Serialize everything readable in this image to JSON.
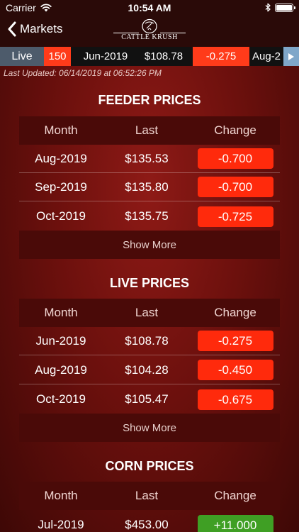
{
  "status_bar": {
    "carrier": "Carrier",
    "time": "10:54 AM"
  },
  "nav": {
    "back_label": "Markets",
    "logo_text": "CATTLE KRUSH"
  },
  "ticker": {
    "live_label": "Live",
    "items": [
      "150",
      "Jun-2019",
      "$108.78",
      "-0.275",
      "Aug-2"
    ]
  },
  "last_updated": "Last Updated: 06/14/2019 at 06:52:26 PM",
  "columns": {
    "month": "Month",
    "last": "Last",
    "change": "Change"
  },
  "feeder": {
    "title": "FEEDER PRICES",
    "rows": [
      {
        "month": "Aug-2019",
        "last": "$135.53",
        "change": "-0.700"
      },
      {
        "month": "Sep-2019",
        "last": "$135.80",
        "change": "-0.700"
      },
      {
        "month": "Oct-2019",
        "last": "$135.75",
        "change": "-0.725"
      }
    ],
    "show_more": "Show More"
  },
  "live": {
    "title": "LIVE PRICES",
    "rows": [
      {
        "month": "Jun-2019",
        "last": "$108.78",
        "change": "-0.275"
      },
      {
        "month": "Aug-2019",
        "last": "$104.28",
        "change": "-0.450"
      },
      {
        "month": "Oct-2019",
        "last": "$105.47",
        "change": "-0.675"
      }
    ],
    "show_more": "Show More"
  },
  "corn": {
    "title": "CORN PRICES",
    "rows": [
      {
        "month": "Jul-2019",
        "last": "$453.00",
        "change": "+11.000"
      }
    ]
  },
  "colors": {
    "negative": "#ff2a0c",
    "positive": "#3f9f24",
    "live_tab": "#4d5b6b",
    "ticker_arrow": "#7fa7c9"
  }
}
